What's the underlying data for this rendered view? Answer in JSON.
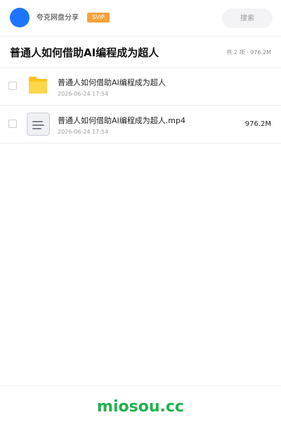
{
  "header": {
    "brand_name": "夸克网盘分享",
    "badge": "SVIP",
    "search_placeholder": "搜索",
    "avatar_color": "#1f74ff",
    "badge_color": "#f6a23a"
  },
  "share": {
    "title": "普通人如何借助AI编程成为超人",
    "summary": "共 2 项 · 976.2M"
  },
  "files": [
    {
      "name": "普通人如何借助AI编程成为超人",
      "date": "2026-06-24 17:54",
      "size": "",
      "icon": "folder-icon",
      "icon_color": "#ffc21d"
    },
    {
      "name": "普通人如何借助AI编程成为超人.mp4",
      "date": "2026-06-24 17:54",
      "size": "976.2M",
      "icon": "document-icon",
      "icon_color": "#eef0f4"
    }
  ],
  "footer": {
    "watermark": "miosou.cc",
    "watermark_color": "#22b14c"
  }
}
